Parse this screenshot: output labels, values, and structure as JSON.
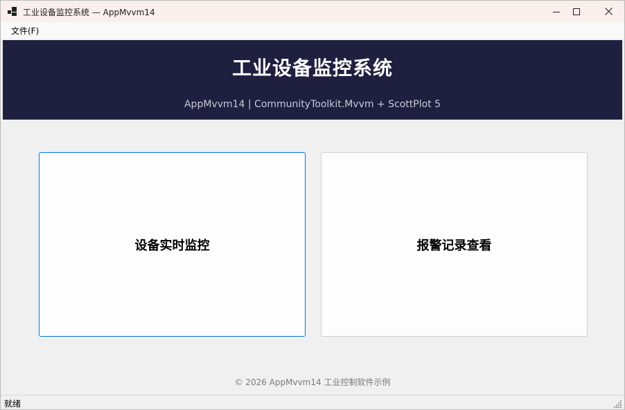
{
  "window": {
    "title": "工业设备监控系统 — AppMvvm14",
    "app_icon": "app-window-icon",
    "controls": {
      "minimize_icon": "minimize-icon",
      "maximize_icon": "maximize-icon",
      "close_icon": "close-icon"
    }
  },
  "menu": {
    "file_label": "文件(F)"
  },
  "header": {
    "title": "工业设备监控系统",
    "subtitle": "AppMvvm14  |  CommunityToolkit.Mvvm + ScottPlot 5",
    "background_color": "#1f1f40"
  },
  "cards": [
    {
      "label": "设备实时监控",
      "focused": true
    },
    {
      "label": "报警记录查看",
      "focused": false
    }
  ],
  "footer": {
    "text": "© 2026  AppMvvm14  工业控制软件示例"
  },
  "status_bar": {
    "text": "就绪"
  },
  "colors": {
    "accent": "#0078d4",
    "titlebar": "#f9efec",
    "window_bg": "#f0f0f0"
  }
}
